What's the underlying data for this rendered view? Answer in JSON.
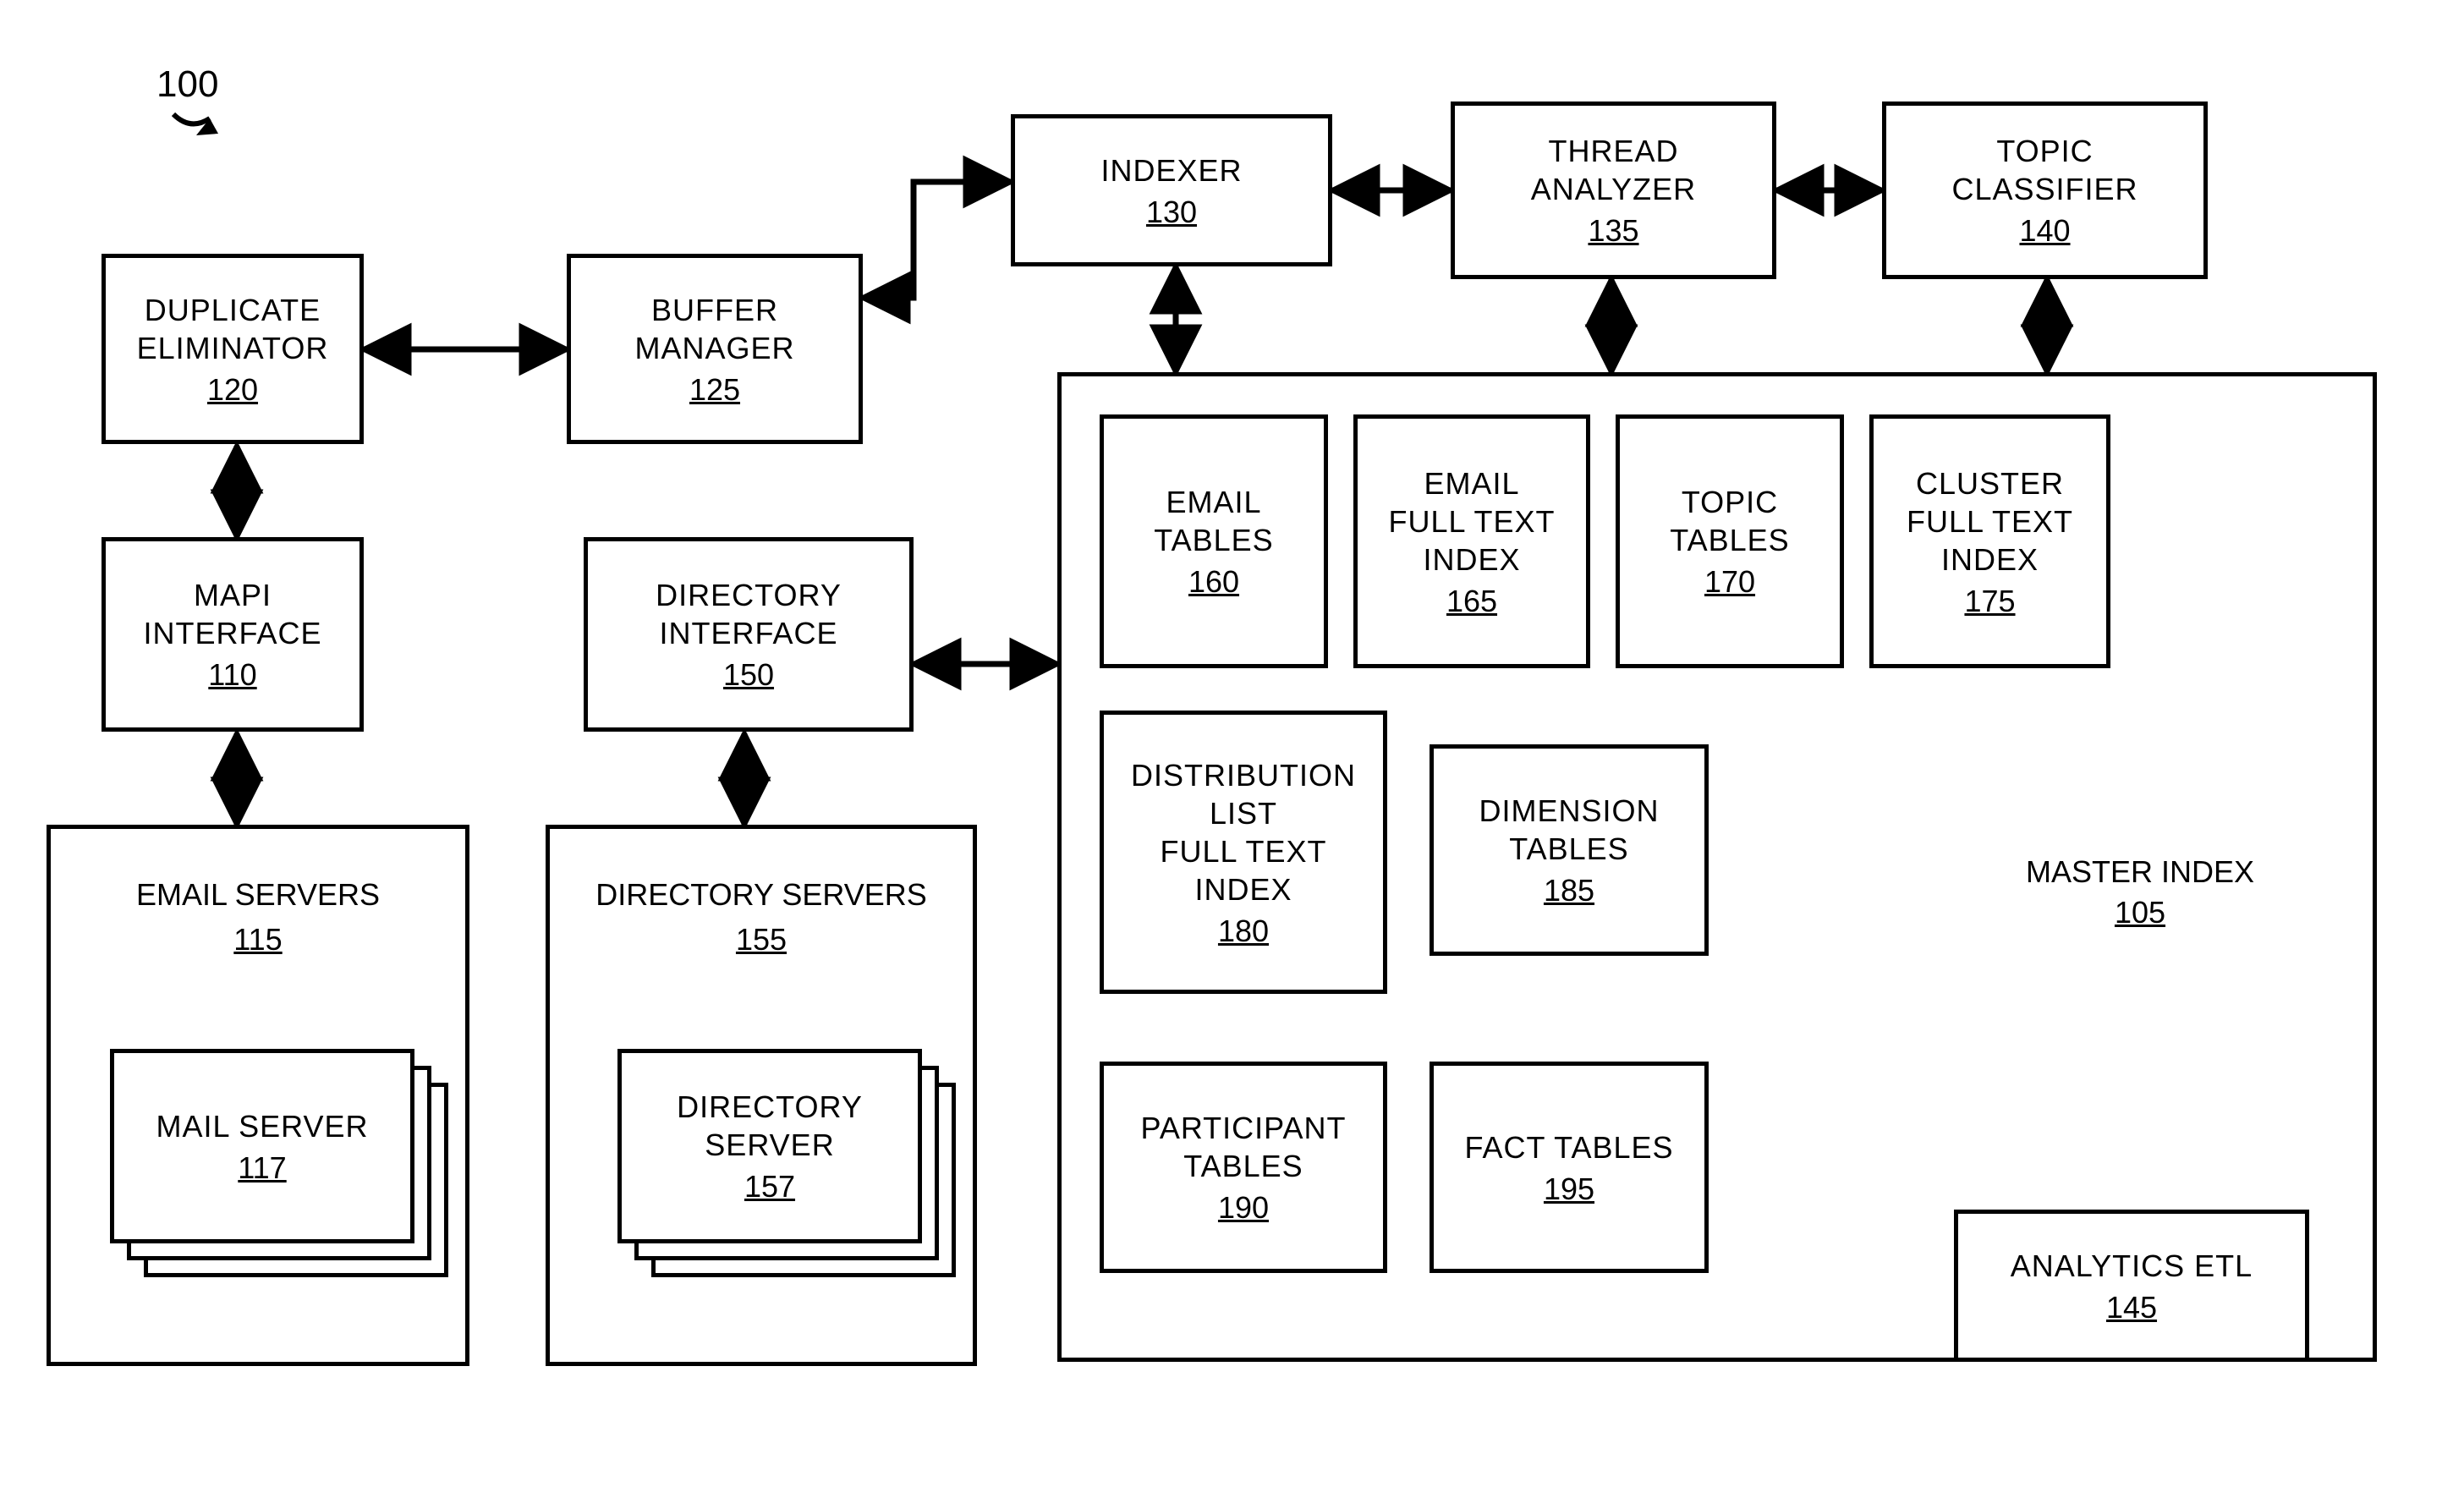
{
  "figure_label": "100",
  "blocks": {
    "duplicate_eliminator": {
      "title": "DUPLICATE\nELIMINATOR",
      "ref": "120"
    },
    "buffer_manager": {
      "title": "BUFFER\nMANAGER",
      "ref": "125"
    },
    "indexer": {
      "title": "INDEXER",
      "ref": "130"
    },
    "thread_analyzer": {
      "title": "THREAD\nANALYZER",
      "ref": "135"
    },
    "topic_classifier": {
      "title": "TOPIC\nCLASSIFIER",
      "ref": "140"
    },
    "mapi_interface": {
      "title": "MAPI\nINTERFACE",
      "ref": "110"
    },
    "directory_interface": {
      "title": "DIRECTORY\nINTERFACE",
      "ref": "150"
    },
    "email_servers": {
      "title": "EMAIL SERVERS",
      "ref": "115"
    },
    "mail_server": {
      "title": "MAIL SERVER",
      "ref": "117"
    },
    "directory_servers": {
      "title": "DIRECTORY SERVERS",
      "ref": "155"
    },
    "directory_server": {
      "title": "DIRECTORY\nSERVER",
      "ref": "157"
    },
    "master_index": {
      "title": "MASTER INDEX",
      "ref": "105"
    },
    "email_tables": {
      "title": "EMAIL\nTABLES",
      "ref": "160"
    },
    "email_fulltext": {
      "title": "EMAIL\nFULL TEXT\nINDEX",
      "ref": "165"
    },
    "topic_tables": {
      "title": "TOPIC\nTABLES",
      "ref": "170"
    },
    "cluster_fulltext": {
      "title": "CLUSTER\nFULL TEXT\nINDEX",
      "ref": "175"
    },
    "dist_list_fulltext": {
      "title": "DISTRIBUTION\nLIST\nFULL TEXT\nINDEX",
      "ref": "180"
    },
    "dimension_tables": {
      "title": "DIMENSION\nTABLES",
      "ref": "185"
    },
    "participant_tables": {
      "title": "PARTICIPANT\nTABLES",
      "ref": "190"
    },
    "fact_tables": {
      "title": "FACT TABLES",
      "ref": "195"
    },
    "analytics_etl": {
      "title": "ANALYTICS ETL",
      "ref": "145"
    }
  }
}
